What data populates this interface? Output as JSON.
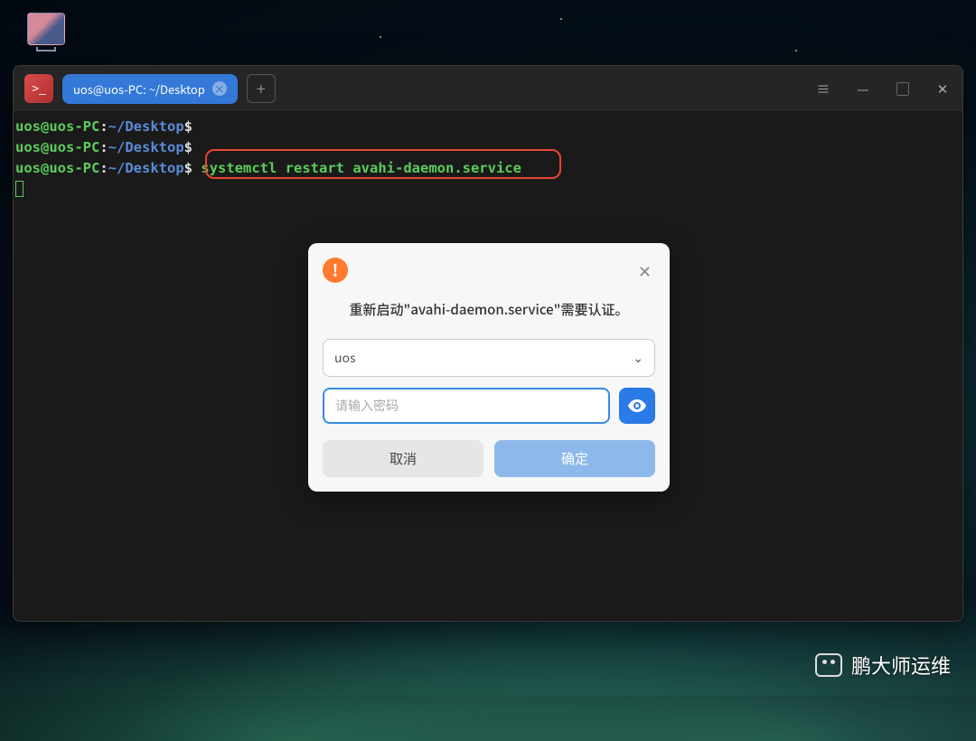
{
  "tab": {
    "title": "uos@uos-PC: ~/Desktop"
  },
  "terminal": {
    "lines": [
      {
        "user": "uos@uos-PC",
        "path": "~/Desktop",
        "cmd": ""
      },
      {
        "user": "uos@uos-PC",
        "path": "~/Desktop",
        "cmd": ""
      },
      {
        "user": "uos@uos-PC",
        "path": "~/Desktop",
        "cmd": "systemctl restart avahi-daemon.service"
      }
    ]
  },
  "dialog": {
    "message": "重新启动\"avahi-daemon.service\"需要认证。",
    "user": "uos",
    "password_placeholder": "请输入密码",
    "cancel": "取消",
    "ok": "确定"
  },
  "watermark": "鹏大师运维"
}
